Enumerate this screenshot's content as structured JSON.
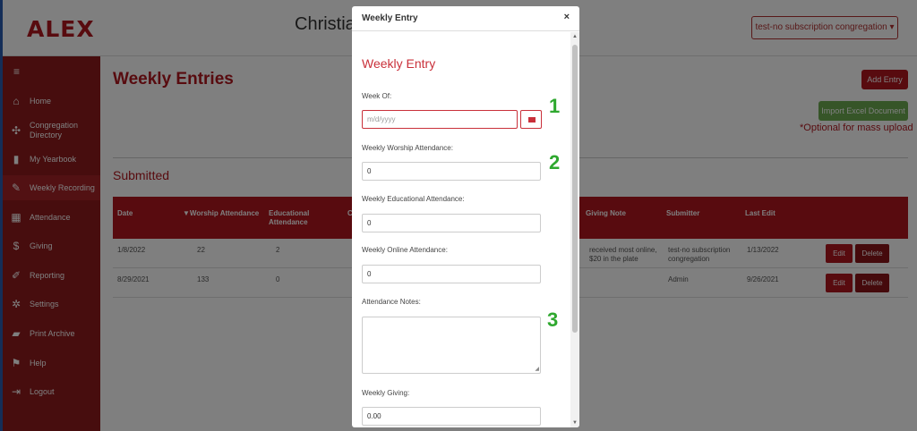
{
  "app": {
    "logo": "ALEX",
    "header_title": "Christia",
    "congregation_select": "test-no subscription congregation ▾"
  },
  "sidebar": {
    "toggle": "≡",
    "items": [
      {
        "label": "Home",
        "icon": "home-icon"
      },
      {
        "label": "Congregation Directory",
        "icon": "directory-icon"
      },
      {
        "label": "My Yearbook",
        "icon": "bookmark-icon"
      },
      {
        "label": "Weekly Recording",
        "icon": "edit-icon",
        "active": true
      },
      {
        "label": "Attendance",
        "icon": "calendar-icon"
      },
      {
        "label": "Giving",
        "icon": "dollar-icon"
      },
      {
        "label": "Reporting",
        "icon": "pencil-icon"
      },
      {
        "label": "Settings",
        "icon": "gear-icon"
      },
      {
        "label": "Print Archive",
        "icon": "folder-icon"
      },
      {
        "label": "Help",
        "icon": "flag-icon"
      },
      {
        "label": "Logout",
        "icon": "logout-icon"
      }
    ]
  },
  "main": {
    "title": "Weekly Entries",
    "add_entry": "Add Entry",
    "import_button": "Import Excel Document",
    "optional_note": "*Optional for mass upload",
    "section_title": "Submitted",
    "columns": {
      "date": "Date",
      "worship": "▼Worship Attendance",
      "educational": "Educational Attendance",
      "c": "C",
      "giving_note": "Giving Note",
      "submitter": "Submitter",
      "last_edit": "Last Edit"
    },
    "rows": [
      {
        "date": "1/8/2022",
        "worship": "22",
        "educational": "2",
        "giving_note": "received most online, $20 in the plate",
        "submitter": "test-no subscription congregation",
        "last_edit": "1/13/2022",
        "edit": "Edit",
        "delete": "Delete"
      },
      {
        "date": "8/29/2021",
        "worship": "133",
        "educational": "0",
        "giving_note": "",
        "submitter": "Admin",
        "last_edit": "9/26/2021",
        "edit": "Edit",
        "delete": "Delete"
      }
    ]
  },
  "modal": {
    "title": "Weekly Entry",
    "close": "×",
    "form_heading": "Weekly Entry",
    "week_of_label": "Week Of:",
    "week_of_placeholder": "m/d/yyyy",
    "worship_label": "Weekly Worship Attendance:",
    "worship_value": "0",
    "educational_label": "Weekly Educational Attendance:",
    "educational_value": "0",
    "online_label": "Weekly Online Attendance:",
    "online_value": "0",
    "notes_label": "Attendance Notes:",
    "giving_label": "Weekly Giving:",
    "giving_value": "0.00"
  },
  "annotations": [
    "1",
    "2",
    "3"
  ],
  "colors": {
    "brand_red": "#b0171f",
    "sidebar_bg": "#8e1b1d",
    "import_green": "#6cab50",
    "annotation_green": "#2fa82f"
  }
}
